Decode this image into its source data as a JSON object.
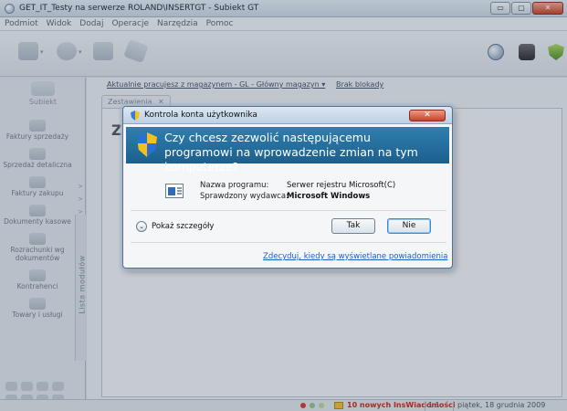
{
  "window": {
    "title": "GET_IT_Testy na serwerze ROLAND\\INSERTGT - Subiekt GT",
    "minimize": "▭",
    "maximize": "▢",
    "close": "✕"
  },
  "menu": [
    "Podmiot",
    "Widok",
    "Dodaj",
    "Operacje",
    "Narzędzia",
    "Pomoc"
  ],
  "sidebar": {
    "header_label": "Subiekt",
    "items": [
      {
        "label": "Faktury sprzedaży",
        "icon": "invoice-icon"
      },
      {
        "label": "Sprzedaż detaliczna",
        "icon": "retail-icon"
      },
      {
        "label": "Faktury zakupu",
        "icon": "purchase-icon"
      },
      {
        "label": "Dokumenty kasowe",
        "icon": "cash-icon"
      },
      {
        "label": "Rozrachunki wg dokumentów",
        "icon": "settlement-icon"
      },
      {
        "label": "Kontrahenci",
        "icon": "contractors-icon"
      },
      {
        "label": "Towary i usługi",
        "icon": "goods-icon"
      }
    ],
    "modules_tab": "Lista modułów",
    "arrows": "> > > > > >"
  },
  "main": {
    "context_link": "Aktualnie pracujesz z magazynem - GL - Główny magazyn ▾",
    "lock_link": "Brak blokady",
    "tab_label": "Zestawienia",
    "tab_close": "✕",
    "heading": "Zes"
  },
  "statusbar": {
    "notifications": "10 nowych InsWiadomości",
    "count": "1 1",
    "date": "piątek, 18 grudnia 2009"
  },
  "dialog": {
    "title": "Kontrola konta użytkownika",
    "close": "✕",
    "question": "Czy chcesz zezwolić następującemu programowi na wprowadzenie zmian na tym komputerze?",
    "program_label": "Nazwa programu:",
    "program_value": "Serwer rejestru Microsoft(C)",
    "publisher_label": "Sprawdzony wydawca:",
    "publisher_value": "Microsoft Windows",
    "details_toggle": "⌄",
    "details_label": "Pokaż szczegóły",
    "yes_button": "Tak",
    "no_button": "Nie",
    "notify_link": "Zdecyduj, kiedy są wyświetlane powiadomienia"
  },
  "colors": {
    "banner": "#1c5f8e",
    "link": "#1a5fc2",
    "notification": "#c12b1e"
  }
}
